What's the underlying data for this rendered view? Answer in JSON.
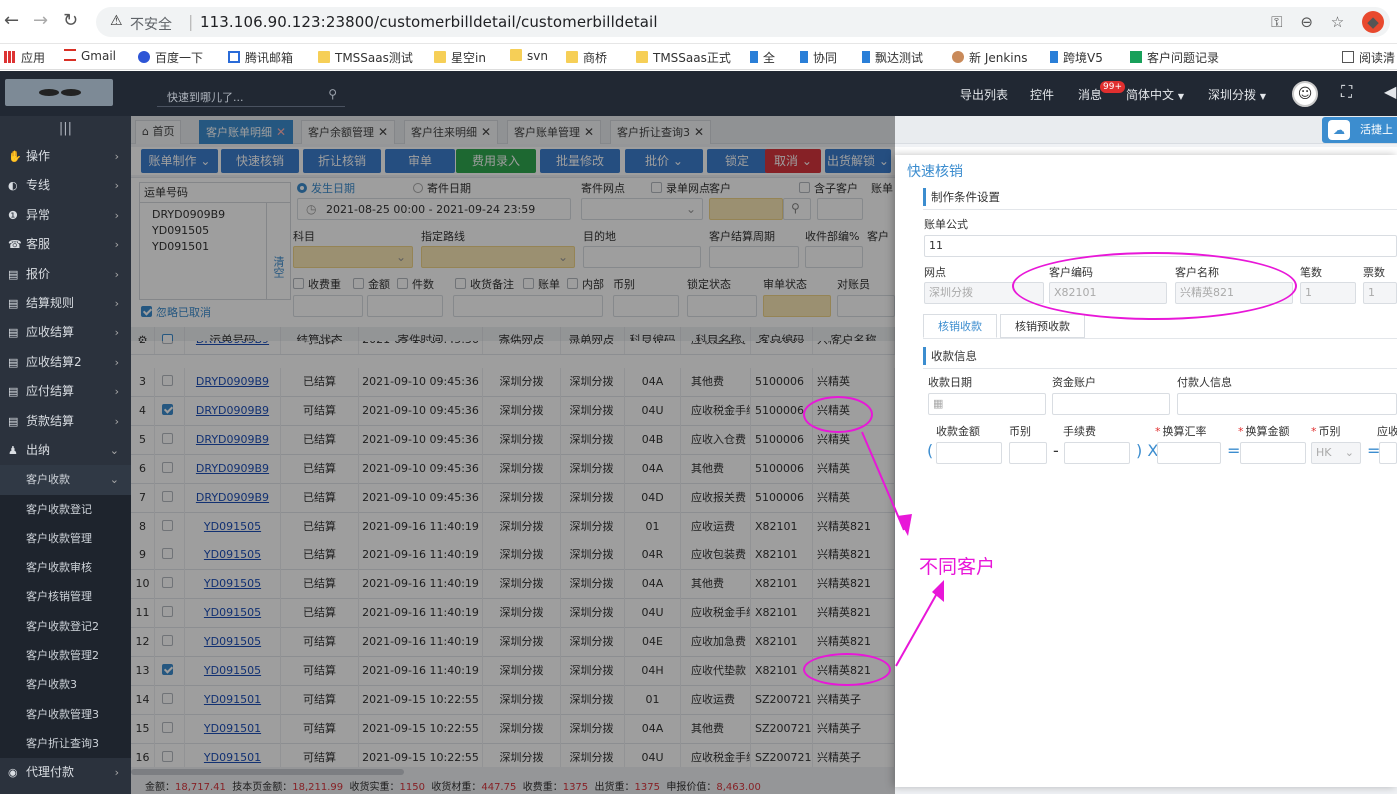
{
  "browser": {
    "insecure_label": "不安全",
    "url": "113.106.90.123:23800/customerbilldetail/customerbilldetail"
  },
  "bookmarks": [
    "应用",
    "Gmail",
    "百度一下",
    "腾讯邮箱",
    "TMSSaas测试",
    "星空in",
    "svn",
    "商桥",
    "TMSSaas正式",
    "全",
    "协同",
    "飘达测试",
    "新 Jenkins",
    "跨境V5",
    "客户问题记录",
    "阅读清"
  ],
  "topbar": {
    "search_placeholder": "快速到哪儿了...",
    "export_list": "导出列表",
    "controls": "控件",
    "messages": "消息",
    "message_count": "99+",
    "language": "简体中文",
    "branch": "深圳分拨"
  },
  "sidebar": {
    "items": [
      "操作",
      "专线",
      "异常",
      "客服",
      "报价",
      "结算规则",
      "应收结算",
      "应收结算2",
      "应付结算",
      "货款结算",
      "出纳"
    ],
    "expanded": "客户收款",
    "subitems": [
      "客户收款登记",
      "客户收款管理",
      "客户收款审核",
      "客户核销管理",
      "客户收款登记2",
      "客户收款管理2",
      "客户收款3",
      "客户收款管理3",
      "客户折让查询3"
    ],
    "last": "代理付款"
  },
  "tabs": [
    "首页",
    "客户账单明细",
    "客户余额管理",
    "客户往来明细",
    "客户账单管理",
    "客户折让查询3"
  ],
  "toolbar": [
    "账单制作",
    "快速核销",
    "折让核销",
    "审单",
    "费用录入",
    "批量修改",
    "批价",
    "锁定",
    "取消",
    "出货解锁"
  ],
  "filter": {
    "waybill_label": "运单号码",
    "waybills": [
      "DRYD0909B9",
      "YD091505",
      "YD091501"
    ],
    "clear": "清空",
    "ignore_cancel": "忽略已取消",
    "send_date": "发生日期",
    "ship_date": "寄件日期",
    "date_range": "2021-08-25 00:00  -  2021-09-24 23:59",
    "origin": "寄件网点",
    "entry": "录单网点",
    "customer": "客户",
    "sub_customer": "含子客户",
    "waybill_no": "账单",
    "subject": "科目",
    "route": "指定路线",
    "destination": "目的地",
    "settle_cycle": "客户结算周期",
    "collect_pct": "收件部编%",
    "cust2": "客户",
    "fee_weight": "收费重",
    "amount": "金额",
    "pieces": "件数",
    "remarks": "收货备注",
    "account": "账单",
    "internal": "内部",
    "currency": "币别",
    "lock_status": "锁定状态",
    "audit_status": "审单状态",
    "checker": "对账员"
  },
  "grid": {
    "headers": [
      "运单号码",
      "结算状态",
      "寄件时间",
      "寄件网点",
      "录单网点",
      "科目编码",
      "科目名称",
      "客户编码",
      "客户名称"
    ],
    "rows": [
      {
        "n": "2",
        "wb": "DRYD0909B9",
        "st": "可结算",
        "t": "2021-09-10 09:45:36",
        "o": "深圳分拨",
        "e": "深圳分拨",
        "c": "04I",
        "nm": "应收超重费",
        "cc": "5100006",
        "cn": "兴精英",
        "chk": false
      },
      {
        "n": "3",
        "wb": "DRYD0909B9",
        "st": "已结算",
        "t": "2021-09-10 09:45:36",
        "o": "深圳分拨",
        "e": "深圳分拨",
        "c": "04A",
        "nm": "其他费",
        "cc": "5100006",
        "cn": "兴精英",
        "chk": false
      },
      {
        "n": "4",
        "wb": "DRYD0909B9",
        "st": "可结算",
        "t": "2021-09-10 09:45:36",
        "o": "深圳分拨",
        "e": "深圳分拨",
        "c": "04U",
        "nm": "应收税金手续",
        "cc": "5100006",
        "cn": "兴精英",
        "chk": true
      },
      {
        "n": "5",
        "wb": "DRYD0909B9",
        "st": "已结算",
        "t": "2021-09-10 09:45:36",
        "o": "深圳分拨",
        "e": "深圳分拨",
        "c": "04B",
        "nm": "应收入仓费",
        "cc": "5100006",
        "cn": "兴精英",
        "chk": false
      },
      {
        "n": "6",
        "wb": "DRYD0909B9",
        "st": "已结算",
        "t": "2021-09-10 09:45:36",
        "o": "深圳分拨",
        "e": "深圳分拨",
        "c": "04A",
        "nm": "其他费",
        "cc": "5100006",
        "cn": "兴精英",
        "chk": false
      },
      {
        "n": "7",
        "wb": "DRYD0909B9",
        "st": "已结算",
        "t": "2021-09-10 09:45:36",
        "o": "深圳分拨",
        "e": "深圳分拨",
        "c": "04D",
        "nm": "应收报关费",
        "cc": "5100006",
        "cn": "兴精英",
        "chk": false
      },
      {
        "n": "8",
        "wb": "YD091505",
        "st": "已结算",
        "t": "2021-09-16 11:40:19",
        "o": "深圳分拨",
        "e": "深圳分拨",
        "c": "01",
        "nm": "应收运费",
        "cc": "X82101",
        "cn": "兴精英821",
        "chk": false
      },
      {
        "n": "9",
        "wb": "YD091505",
        "st": "已结算",
        "t": "2021-09-16 11:40:19",
        "o": "深圳分拨",
        "e": "深圳分拨",
        "c": "04R",
        "nm": "应收包装费",
        "cc": "X82101",
        "cn": "兴精英821",
        "chk": false
      },
      {
        "n": "10",
        "wb": "YD091505",
        "st": "已结算",
        "t": "2021-09-16 11:40:19",
        "o": "深圳分拨",
        "e": "深圳分拨",
        "c": "04A",
        "nm": "其他费",
        "cc": "X82101",
        "cn": "兴精英821",
        "chk": false
      },
      {
        "n": "11",
        "wb": "YD091505",
        "st": "已结算",
        "t": "2021-09-16 11:40:19",
        "o": "深圳分拨",
        "e": "深圳分拨",
        "c": "04U",
        "nm": "应收税金手续",
        "cc": "X82101",
        "cn": "兴精英821",
        "chk": false
      },
      {
        "n": "12",
        "wb": "YD091505",
        "st": "可结算",
        "t": "2021-09-16 11:40:19",
        "o": "深圳分拨",
        "e": "深圳分拨",
        "c": "04E",
        "nm": "应收加急费",
        "cc": "X82101",
        "cn": "兴精英821",
        "chk": false
      },
      {
        "n": "13",
        "wb": "YD091505",
        "st": "可结算",
        "t": "2021-09-16 11:40:19",
        "o": "深圳分拨",
        "e": "深圳分拨",
        "c": "04H",
        "nm": "应收代垫款",
        "cc": "X82101",
        "cn": "兴精英821",
        "chk": true
      },
      {
        "n": "14",
        "wb": "YD091501",
        "st": "可结算",
        "t": "2021-09-15 10:22:55",
        "o": "深圳分拨",
        "e": "深圳分拨",
        "c": "01",
        "nm": "应收运费",
        "cc": "SZ2007212C",
        "cn": "兴精英子",
        "chk": false
      },
      {
        "n": "15",
        "wb": "YD091501",
        "st": "可结算",
        "t": "2021-09-15 10:22:55",
        "o": "深圳分拨",
        "e": "深圳分拨",
        "c": "04A",
        "nm": "其他费",
        "cc": "SZ2007212C",
        "cn": "兴精英子",
        "chk": false
      },
      {
        "n": "16",
        "wb": "YD091501",
        "st": "可结算",
        "t": "2021-09-15 10:22:55",
        "o": "深圳分拨",
        "e": "深圳分拨",
        "c": "04U",
        "nm": "应收税金手续",
        "cc": "SZ2007212C",
        "cn": "兴精英子",
        "chk": false
      }
    ]
  },
  "footer": {
    "total_label": "金额：",
    "total": "18,717.41",
    "page_label": "技本页金额：",
    "page_total": "18,211.99",
    "weight_label": "收货实重：",
    "weight": "1150",
    "vol_label": "收货材重：",
    "vol": "447.75",
    "fee_label": "收费重：",
    "fee": "1375",
    "out_label": "出货重：",
    "out": "1375",
    "price_label": "申报价值：",
    "price": "8,463.00"
  },
  "modal": {
    "title": "快速核销",
    "section1": "制作条件设置",
    "formula_label": "账单公式",
    "formula_value": "11",
    "site_label": "网点",
    "site_value": "深圳分拨",
    "cust_code_label": "客户编码",
    "cust_code_value": "X82101",
    "cust_name_label": "客户名称",
    "cust_name_value": "兴精英821",
    "count_label": "笔数",
    "count_value": "1",
    "tickets_label": "票数",
    "tickets_value": "1",
    "subtab1": "核销收款",
    "subtab2": "核销预收款",
    "section2": "收款信息",
    "recv_date": "收款日期",
    "fund_account": "资金账户",
    "payer_info": "付款人信息",
    "recv_amount": "收款金额",
    "currency": "币别",
    "fee": "手续费",
    "rate": "换算汇率",
    "conv_amount": "换算金额",
    "currency2": "币别",
    "currency2_value": "HK",
    "receivable": "应收",
    "sym_open": "(",
    "sym_minus": "-",
    "sym_closex": ") X",
    "sym_eq1": "=",
    "sym_eq2": "="
  },
  "annotation": {
    "text": "不同客户",
    "color": "#e817d8"
  },
  "cloud_badge": "活捷上"
}
